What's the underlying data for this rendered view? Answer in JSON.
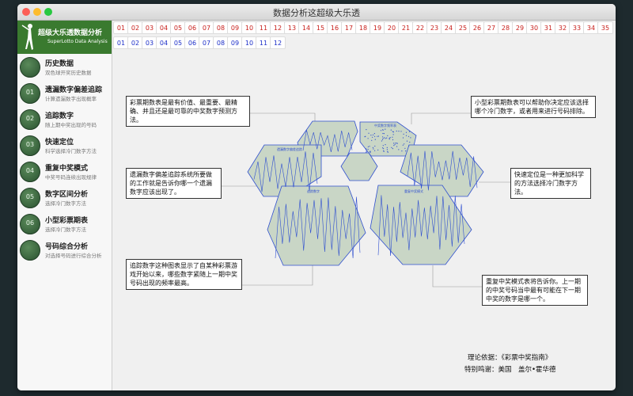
{
  "window": {
    "title": "数据分析这超级大乐透"
  },
  "brand": {
    "title": "超级大乐透数据分析",
    "subtitle": "SuperLotto Data Analysis"
  },
  "sidebar": {
    "items": [
      {
        "title": "历史数据",
        "subtitle": "双色球开奖历史数据",
        "icon": "clock-icon",
        "badge": ""
      },
      {
        "title": "遗漏数字偏差追踪",
        "subtitle": "计算遗漏数字出现概率",
        "icon": "omission-icon",
        "badge": "01"
      },
      {
        "title": "追踪数字",
        "subtitle": "随上期中奖出现的号码",
        "icon": "tracking-icon",
        "badge": "02"
      },
      {
        "title": "快速定位",
        "subtitle": "科学选择冷门数字方法",
        "icon": "locate-icon",
        "badge": "03"
      },
      {
        "title": "重复中奖模式",
        "subtitle": "中奖号码连续出现规律",
        "icon": "repeat-icon",
        "badge": "04"
      },
      {
        "title": "数字区间分析",
        "subtitle": "选择冷门数字方法",
        "icon": "range-icon",
        "badge": "05"
      },
      {
        "title": "小型彩票期表",
        "subtitle": "选择冷门数字方法",
        "icon": "table-icon",
        "badge": "06"
      },
      {
        "title": "号码综合分析",
        "subtitle": "对选择号码进行综合分析",
        "icon": "golfer-icon",
        "badge": ""
      }
    ]
  },
  "numbers": {
    "red": [
      "01",
      "02",
      "03",
      "04",
      "05",
      "06",
      "07",
      "08",
      "09",
      "10",
      "11",
      "12",
      "13",
      "14",
      "15",
      "16",
      "17",
      "18",
      "19",
      "20",
      "21",
      "22",
      "23",
      "24",
      "25",
      "26",
      "27",
      "28",
      "29",
      "30",
      "31",
      "32",
      "33",
      "34",
      "35"
    ],
    "blue": [
      "01",
      "02",
      "03",
      "04",
      "05",
      "06",
      "07",
      "08",
      "09",
      "10",
      "11",
      "12"
    ]
  },
  "panels": {
    "top_left_label": "",
    "top_right_label": "中奖数字频率表",
    "mid_left_label": "遗漏数字偏差追踪",
    "bottom_left_label": "追踪数字",
    "bottom_right_label": "重复中奖模式"
  },
  "annotations": {
    "a1": "彩票期数表是最有价值、最重要、最精确、并且还是最可靠的中奖数字预测方法。",
    "a2": "小型彩票期数表可以帮助你决定应该选择哪个冷门数字，或者用来进行号码排除。",
    "a3": "遗漏数字偏差追踪系统所要做的工作就是告诉你哪一个遗漏数字应该出现了。",
    "a4": "快速定位是一种更加科学的方法选择冷门数字方法。",
    "a5": "追踪数字这种图表显示了自某种彩票游戏开始以来，哪些数字紧随上一期中奖号码出现的频率最高。",
    "a6": "重复中奖模式表将告诉你。上一期的中奖号码当中最有可能在下一期中奖的数字是哪一个。"
  },
  "credits": {
    "basis": "理论依据：《彩票中奖指南》",
    "thanks": "特别鸣谢：美国　盖尔•霍华德"
  },
  "colors": {
    "brand_green": "#3a7a2f",
    "red_number": "#c8201c",
    "blue_number": "#1c2ec8",
    "panel_fill": "#c9d6c6",
    "panel_line": "#2f4fd0"
  }
}
